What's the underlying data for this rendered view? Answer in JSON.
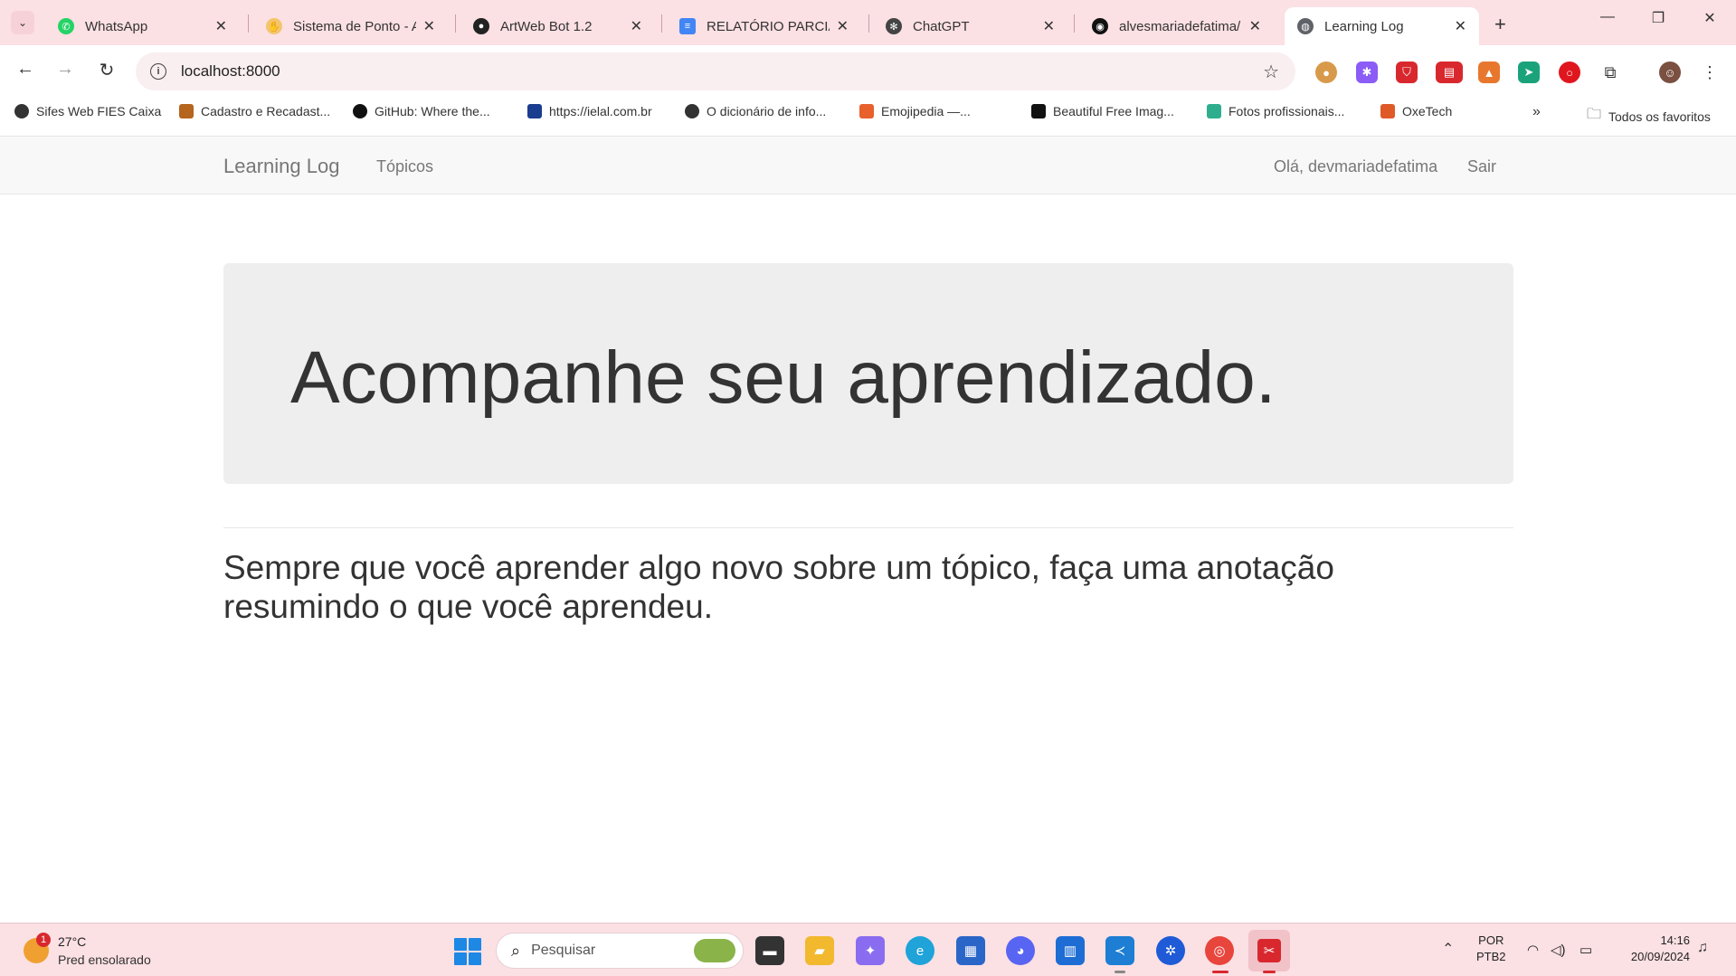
{
  "tabs": [
    {
      "label": "WhatsApp",
      "icon": "whatsapp-icon",
      "color": "#25d366"
    },
    {
      "label": "Sistema de Ponto - A",
      "icon": "hand-icon",
      "color": "#f4c56b"
    },
    {
      "label": "ArtWeb Bot 1.2",
      "icon": "artweb-icon",
      "color": "#222222"
    },
    {
      "label": "RELATÓRIO PARCIAL",
      "icon": "docs-icon",
      "color": "#4285f4"
    },
    {
      "label": "ChatGPT",
      "icon": "chatgpt-icon",
      "color": "#444444"
    },
    {
      "label": "alvesmariadefatima/",
      "icon": "github-icon",
      "color": "#111111"
    },
    {
      "label": "Learning Log",
      "icon": "globe-icon",
      "color": "#5f6368"
    }
  ],
  "toolbar": {
    "url": "localhost:8000"
  },
  "bookmarks": [
    {
      "label": "Sifes Web FIES Caixa",
      "color": "#333333"
    },
    {
      "label": "Cadastro e Recadast...",
      "color": "#b5651d"
    },
    {
      "label": "GitHub: Where the...",
      "color": "#111111"
    },
    {
      "label": "https://ielal.com.br",
      "color": "#1a3d8f"
    },
    {
      "label": "O dicionário de info...",
      "color": "#333333"
    },
    {
      "label": "Emojipedia —...",
      "color": "#e8602c"
    },
    {
      "label": "Beautiful Free Imag...",
      "color": "#111111"
    },
    {
      "label": "Fotos profissionais...",
      "color": "#2fae8e"
    },
    {
      "label": "OxeTech",
      "color": "#e05a28"
    }
  ],
  "bookmarks_all": "Todos os favoritos",
  "site": {
    "brand": "Learning Log",
    "nav_topics": "Tópicos",
    "greeting": "Olá, devmariadefatima",
    "logout": "Sair",
    "headline": "Acompanhe seu aprendizado.",
    "lead": "Sempre que você aprender algo novo sobre um tópico, faça uma anotação resumindo o que você aprendeu."
  },
  "taskbar": {
    "weather_badge": "1",
    "temperature": "27°C",
    "weather_desc": "Pred ensolarado",
    "search_placeholder": "Pesquisar",
    "lang_line1": "POR",
    "lang_line2": "PTB2",
    "time": "14:16",
    "date": "20/09/2024"
  }
}
